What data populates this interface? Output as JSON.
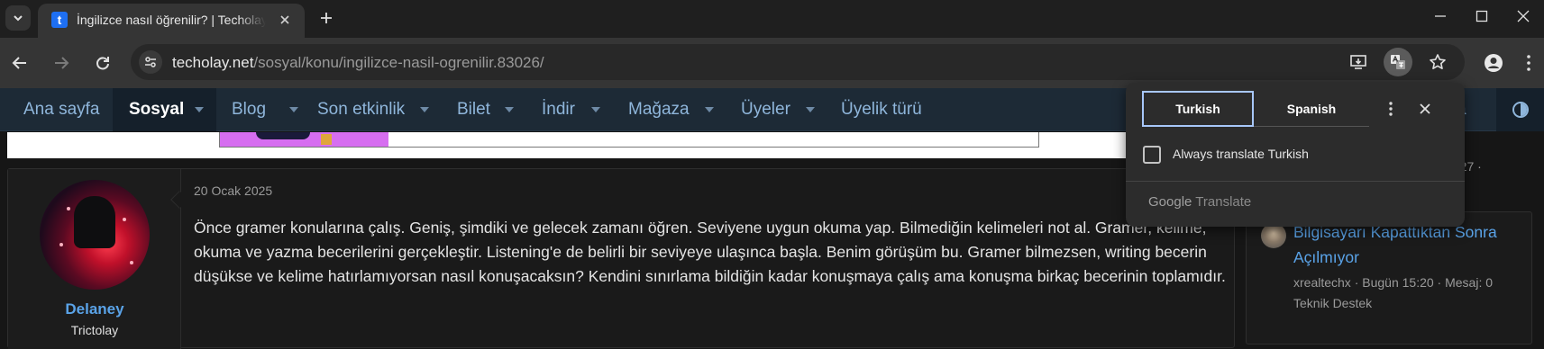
{
  "browser": {
    "tab": {
      "favicon_letter": "t",
      "title": "İngilizce nasıl öğrenilir? | Techolay"
    },
    "url": {
      "host": "techolay.net",
      "path": "/sosyal/konu/ingilizce-nasil-ogrenilir.83026/"
    }
  },
  "nav": {
    "items": [
      {
        "label": "Ana sayfa",
        "active": false,
        "dropdown": false
      },
      {
        "label": "Sosyal",
        "active": true,
        "dropdown": true
      },
      {
        "label": "Blog",
        "active": false,
        "dropdown": true
      },
      {
        "label": "Son etkinlik",
        "active": false,
        "dropdown": true
      },
      {
        "label": "Bilet",
        "active": false,
        "dropdown": true
      },
      {
        "label": "İndir",
        "active": false,
        "dropdown": true
      },
      {
        "label": "Mağaza",
        "active": false,
        "dropdown": true
      },
      {
        "label": "Üyeler",
        "active": false,
        "dropdown": true
      },
      {
        "label": "Üyelik türü",
        "active": false,
        "dropdown": false
      }
    ],
    "right_partial": "a"
  },
  "post": {
    "date": "20 Ocak 2025",
    "author": {
      "name": "Delaney",
      "title": "Trictolay"
    },
    "body": "Önce gramer konularına çalış. Geniş, şimdiki ve gelecek zamanı öğren. Seviyene uygun okuma yap. Bilmediğin kelimeleri not al. Gramer, kelime, okuma ve yazma becerilerini gerçekleştir. Listening'e de belirli bir seviyeye ulaşınca başla. Benim görüşüm bu. Gramer bilmezsen, writing becerin düşükse ve kelime hatırlamıyorsan nasıl konuşacaksın? Kendini sınırlama bildiğin kadar konuşmaya çalış ama konuşma birkaç becerinin toplamıdır."
  },
  "sidebar": {
    "snippet": "5:27 ·",
    "thread": {
      "title": "Bilgisayarı Kapattıktan Sonra Açılmıyor",
      "meta": "xrealtechx · Bugün 15:20 · Mesaj: 0",
      "forum": "Teknik Destek"
    }
  },
  "translate_popup": {
    "tabs": [
      "Turkish",
      "Spanish"
    ],
    "selected_tab": "Turkish",
    "checkbox_label": "Always translate Turkish",
    "checkbox_checked": false,
    "footer_brand": "Google",
    "footer_text": "Translate"
  },
  "icons": {
    "tab_search": "chevron-down-icon",
    "tab_close": "close-icon",
    "new_tab": "plus-icon",
    "minimize": "minimize-icon",
    "maximize": "maximize-icon",
    "close_window": "close-icon",
    "back": "back-arrow-icon",
    "forward": "forward-arrow-icon",
    "reload": "reload-icon",
    "site_info": "tune-icon",
    "install": "install-app-icon",
    "translate": "translate-icon",
    "bookmark": "star-icon",
    "profile": "person-icon",
    "menu": "kebab-menu-icon",
    "theme": "theme-toggle-icon"
  }
}
